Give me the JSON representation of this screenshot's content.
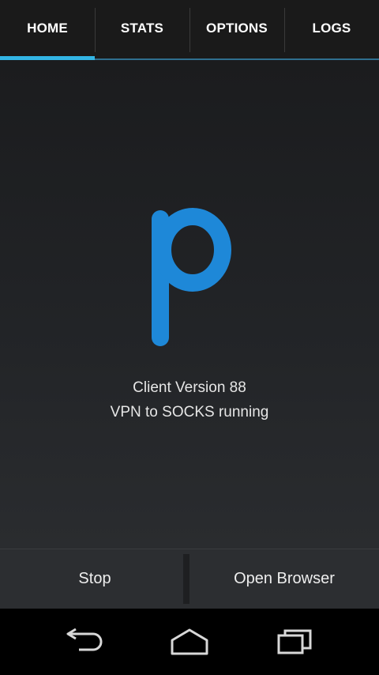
{
  "tabs": [
    {
      "label": "HOME",
      "active": true
    },
    {
      "label": "STATS",
      "active": false
    },
    {
      "label": "OPTIONS",
      "active": false
    },
    {
      "label": "LOGS",
      "active": false
    }
  ],
  "logo": {
    "letter": "p",
    "color": "#1e88d8"
  },
  "status": {
    "version_line": "Client Version 88",
    "state_line": "VPN to SOCKS running"
  },
  "actions": {
    "stop_label": "Stop",
    "open_browser_label": "Open Browser"
  },
  "navbar": {
    "back_icon": "back-arrow-icon",
    "home_icon": "home-icon",
    "recents_icon": "recent-apps-icon"
  },
  "colors": {
    "accent": "#33b5e5",
    "logo_blue": "#1e88d8",
    "background": "#222427"
  }
}
